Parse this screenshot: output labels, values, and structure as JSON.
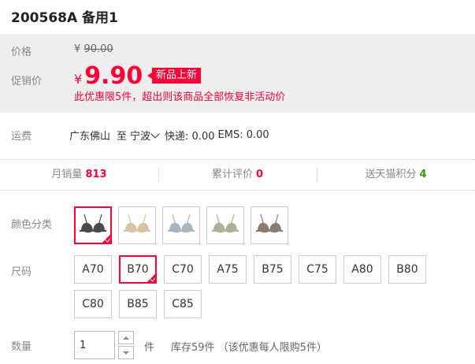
{
  "title": "200568A 备用1",
  "price": {
    "label": "价格",
    "currency": "¥",
    "original": "90.00"
  },
  "promo": {
    "label": "促销价",
    "currency": "¥",
    "value": "9.90",
    "tag": "新品上新",
    "limit_note": "此优惠限5件，超出则该商品全部恢复非活动价"
  },
  "shipping": {
    "label": "运费",
    "from": "广东佛山",
    "to_word": "至",
    "to": "宁波",
    "express": "快递: 0.00",
    "ems": "EMS: 0.00"
  },
  "stats": {
    "monthly_sales_label": "月销量",
    "monthly_sales": "813",
    "reviews_label": "累计评价",
    "reviews": "0",
    "points_label": "送天猫积分",
    "points": "4"
  },
  "color": {
    "label": "颜色分类",
    "swatches": [
      {
        "name": "black",
        "color": "#4a4a4c",
        "selected": true
      },
      {
        "name": "beige",
        "color": "#d9c3a6",
        "selected": false
      },
      {
        "name": "grey-blue",
        "color": "#a9b6bf",
        "selected": false
      },
      {
        "name": "sage-green",
        "color": "#a9b596",
        "selected": false
      },
      {
        "name": "taupe",
        "color": "#8a7c73",
        "selected": false
      }
    ]
  },
  "size": {
    "label": "尺码",
    "options": [
      "A70",
      "B70",
      "C70",
      "A75",
      "B75",
      "C75",
      "A80",
      "B80",
      "C80",
      "B85",
      "C85"
    ],
    "selected": "B70"
  },
  "quantity": {
    "label": "数量",
    "value": "1",
    "unit": "件",
    "stock_note": "库存59件 （该优惠每人限购5件）"
  },
  "colors": {
    "accent": "#ff0036",
    "green": "#339900",
    "price_bg": "#eeeeee"
  }
}
